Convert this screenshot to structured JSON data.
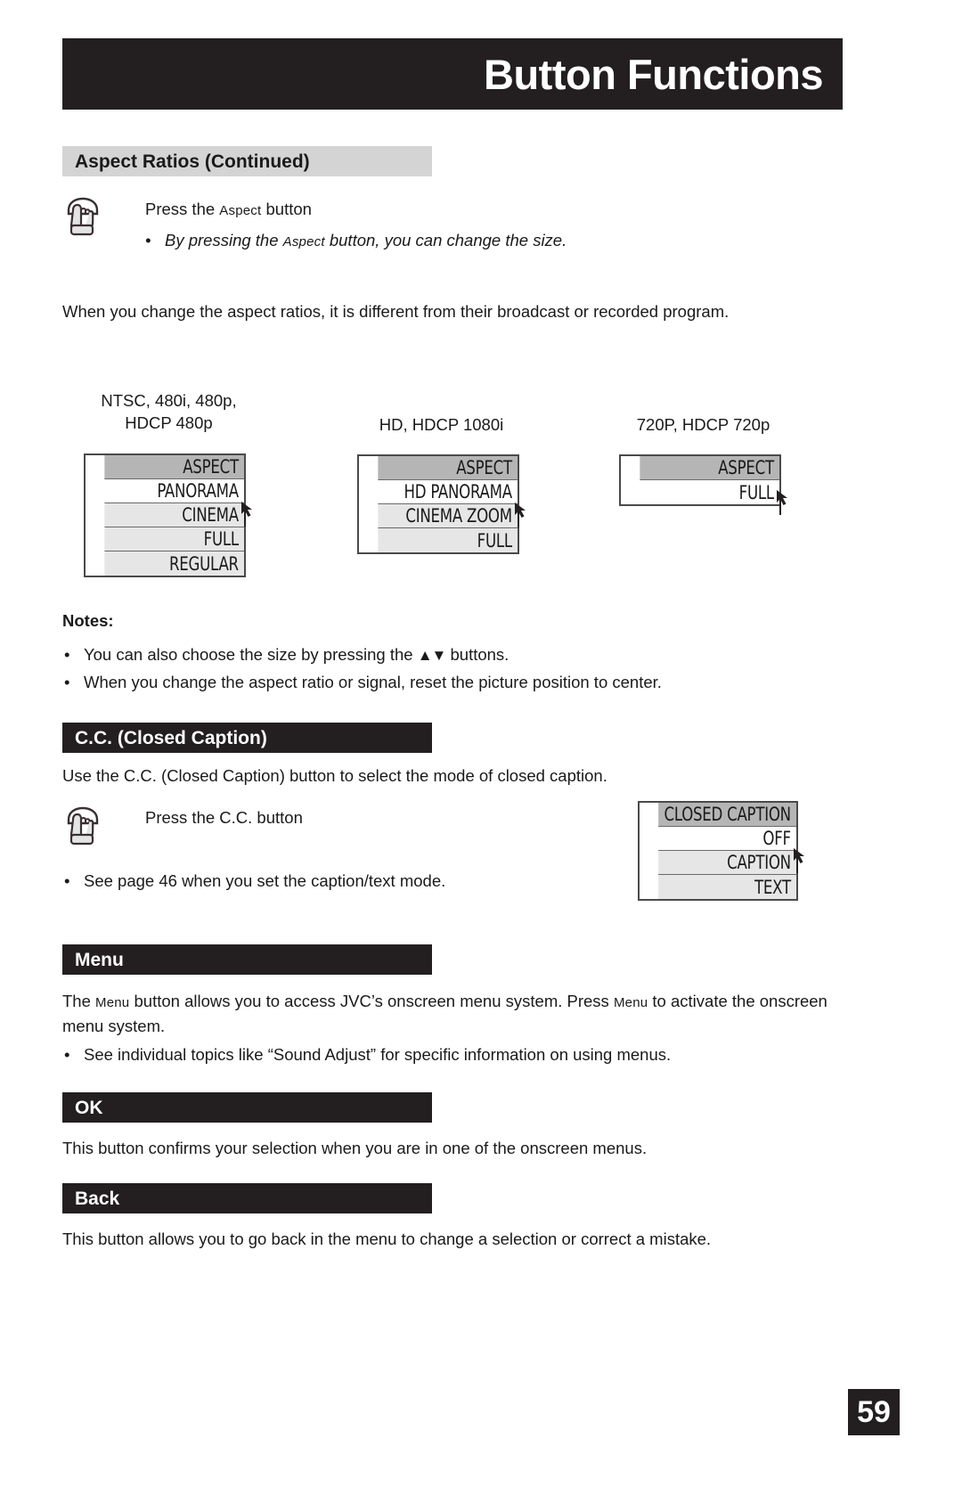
{
  "page": {
    "banner_title": "Button Functions",
    "page_number": "59"
  },
  "sections": {
    "aspect": {
      "heading": "Aspect Ratios (Continued)",
      "press_line_pre": "Press the ",
      "press_line_sc": "Aspect",
      "press_line_post": " button",
      "bullet_pre": "By pressing the ",
      "bullet_sc": "Aspect",
      "bullet_post": " button, you can change the size.",
      "paragraph": "When you change the aspect ratios, it is different from their broadcast or recorded program.",
      "notes_label": "Notes:",
      "notes": [
        {
          "pre": "You can also choose the size by pressing the ",
          "glyph": "▲▼",
          "post": " buttons."
        },
        {
          "pre": "When you change the aspect ratio or signal, reset the picture position to center.",
          "glyph": "",
          "post": ""
        }
      ]
    },
    "cc": {
      "heading": "C.C. (Closed Caption)",
      "intro": "Use the C.C. (Closed Caption) button to select the mode of closed caption.",
      "press_line": "Press the C.C. button",
      "bullet": "See page 46 when you set the caption/text mode."
    },
    "menu": {
      "heading": "Menu",
      "para_a": "The ",
      "para_a_sc": "Menu",
      "para_b": " button allows you to access JVC’s onscreen menu system. Press ",
      "para_b_sc": "Menu",
      "para_c": " to activate the onscreen menu system.",
      "bullet": "See individual topics like “Sound Adjust” for specific information on using menus."
    },
    "ok": {
      "heading": "OK",
      "paragraph": "This button confirms your selection when you are in one of the onscreen menus."
    },
    "back": {
      "heading": "Back",
      "paragraph": "This button allows you to go back in the menu to change a selection or correct a mistake."
    }
  },
  "osd_menus": [
    {
      "caption_line1": "NTSC, 480i, 480p,",
      "caption_line2": "HDCP 480p",
      "rows": [
        {
          "label": "ASPECT",
          "style": "hdr"
        },
        {
          "label": "PANORAMA",
          "style": "white"
        },
        {
          "label": "CINEMA",
          "style": "shade"
        },
        {
          "label": "FULL",
          "style": "shade"
        },
        {
          "label": "REGULAR",
          "style": "shade"
        }
      ]
    },
    {
      "caption_line1": "HD, HDCP 1080i",
      "caption_line2": "",
      "rows": [
        {
          "label": "ASPECT",
          "style": "hdr"
        },
        {
          "label": "HD PANORAMA",
          "style": "white"
        },
        {
          "label": "CINEMA ZOOM",
          "style": "shade"
        },
        {
          "label": "FULL",
          "style": "shade"
        }
      ]
    },
    {
      "caption_line1": "720P, HDCP 720p",
      "caption_line2": "",
      "rows": [
        {
          "label": "ASPECT",
          "style": "hdr"
        },
        {
          "label": "FULL",
          "style": "white"
        }
      ]
    }
  ],
  "cc_menu": {
    "rows": [
      {
        "label": "CLOSED CAPTION",
        "style": "hdr"
      },
      {
        "label": "OFF",
        "style": "white"
      },
      {
        "label": "CAPTION",
        "style": "shade"
      },
      {
        "label": "TEXT",
        "style": "shade"
      }
    ]
  },
  "colors": {
    "banner_bg": "#231f20",
    "gray_head_bg": "#d4d4d4",
    "osd_header_bg": "#b5b5b5",
    "osd_row_shade": "#e6e6e6",
    "text": "#1a1a1a"
  },
  "icons": {
    "hand": "hand-press-icon",
    "cursor": "cursor-arrow-icon"
  }
}
